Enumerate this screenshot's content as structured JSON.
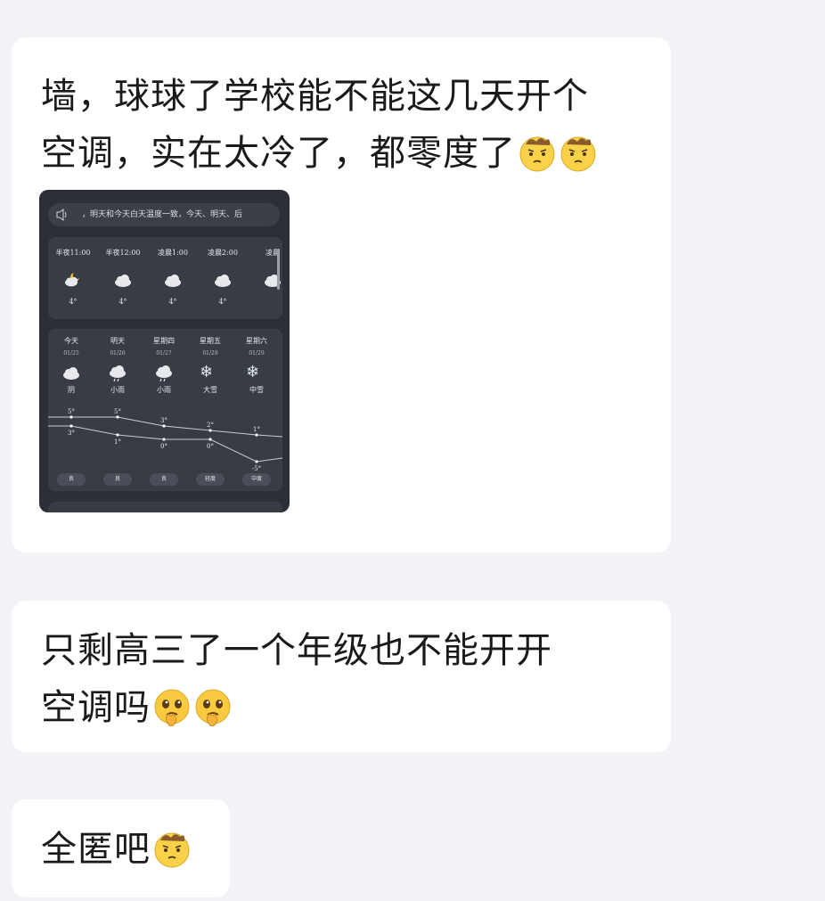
{
  "messages": [
    {
      "line1": "墙，球球了学校能不能这几天开个",
      "line2": "空调，实在太冷了，都零度了",
      "emoji": [
        "worried-face",
        "worried-face"
      ]
    },
    {
      "line1": "只剩高三了一个年级也不能开开",
      "line2": "空调吗",
      "emoji": [
        "pleading-face",
        "pleading-face"
      ]
    },
    {
      "line1": "全匿吧",
      "emoji": [
        "worried-face"
      ]
    }
  ],
  "weather": {
    "ticker": "，明天和今天白天温度一致，今天、明天、后",
    "hourly": [
      {
        "time": "半夜11:00",
        "icon": "moon-cloud-icon",
        "temp": "4°"
      },
      {
        "time": "半夜12:00",
        "icon": "cloud-icon",
        "temp": "4°"
      },
      {
        "time": "凌晨1:00",
        "icon": "cloud-icon",
        "temp": "4°"
      },
      {
        "time": "凌晨2:00",
        "icon": "cloud-icon",
        "temp": "4°"
      },
      {
        "time": "凌晨",
        "icon": "cloud-icon",
        "temp": ""
      }
    ],
    "daily": [
      {
        "day": "今天",
        "date": "01/25",
        "icon": "cloud-icon",
        "cond": "阴",
        "high": "5°",
        "low": "3°",
        "aqi": "良"
      },
      {
        "day": "明天",
        "date": "01/26",
        "icon": "rain-icon",
        "cond": "小雨",
        "high": "5°",
        "low": "1°",
        "aqi": "良"
      },
      {
        "day": "星期四",
        "date": "01/27",
        "icon": "rain-icon",
        "cond": "小雨",
        "high": "3°",
        "low": "0°",
        "aqi": "良"
      },
      {
        "day": "星期五",
        "date": "01/28",
        "icon": "snow-icon",
        "cond": "大雪",
        "high": "2°",
        "low": "0°",
        "aqi": "轻度"
      },
      {
        "day": "星期六",
        "date": "01/29",
        "icon": "snow-icon",
        "cond": "中雪",
        "high": "1°",
        "low": "-5°",
        "aqi": "中度"
      }
    ],
    "high_values": [
      5,
      5,
      3,
      2,
      1
    ],
    "low_values": [
      3,
      1,
      0,
      0,
      -5
    ]
  }
}
